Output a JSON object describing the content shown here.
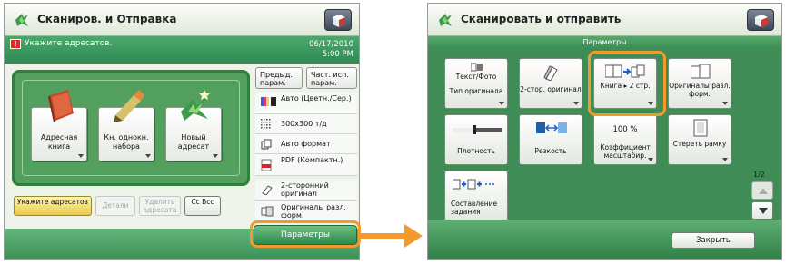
{
  "left_screen": {
    "title": "Сканиров. и Отправка",
    "status_message": "Укажите адресатов.",
    "date": "06/17/2010",
    "time": "5:00 PM",
    "main_buttons": [
      {
        "label": "Адресная книга",
        "icon": "address-book-icon"
      },
      {
        "label": "Кн. однокн. набора",
        "icon": "one-touch-icon"
      },
      {
        "label": "Новый адресат",
        "icon": "new-destination-icon"
      }
    ],
    "top_right_buttons": [
      "Предыд. парам.",
      "Част. исп. парам."
    ],
    "settings": [
      {
        "label": "Авто (Цветн./Сер.)",
        "icon": "color-mode-icon"
      },
      {
        "label": "300x300 т/д",
        "icon": "resolution-icon"
      },
      {
        "label": "Авто формат",
        "icon": "scan-size-icon"
      },
      {
        "label": "PDF (Компактн.)",
        "icon": "pdf-icon"
      },
      {
        "label": "2-сторонний оригинал",
        "icon": "duplex-original-icon"
      },
      {
        "label": "Оригиналы разл. форм.",
        "icon": "different-size-originals-icon"
      }
    ],
    "bottom_buttons": {
      "specify": "Укажите адресатов",
      "details": "Детали",
      "delete": "Удалить адресата",
      "cc_bcc": "Cc Bcc"
    },
    "options_button": "Параметры"
  },
  "right_screen": {
    "title": "Сканировать и отправить",
    "subtitle": "Параметры",
    "options": [
      {
        "label": "Текст/Фото\nТип оригинала",
        "top": "Текст/Фото",
        "bottom": "Тип оригинала",
        "icon": "original-type-icon"
      },
      {
        "label": "2-стор. оригинал",
        "icon": "duplex-icon"
      },
      {
        "label": "Книга ▸ 2 стр.",
        "icon": "book-to-2-pages-icon"
      },
      {
        "label": "Оригиналы разл. форм.",
        "icon": "different-sizes-icon"
      },
      {
        "label": "Плотность",
        "icon": "density-slider-icon"
      },
      {
        "label": "Резкость",
        "icon": "sharpness-icon"
      },
      {
        "label": "Коэффициент масштабир.",
        "value": "100 %",
        "icon": "zoom-icon"
      },
      {
        "label": "Стереть рамку",
        "icon": "erase-frame-icon"
      },
      {
        "label": "Составление задания",
        "icon": "job-build-icon"
      }
    ],
    "page_indicator": "1/2",
    "close_button": "Закрыть"
  },
  "colors": {
    "accent_orange": "#f29a2e",
    "green": "#3f8c56",
    "warning": "#e02b2b"
  }
}
